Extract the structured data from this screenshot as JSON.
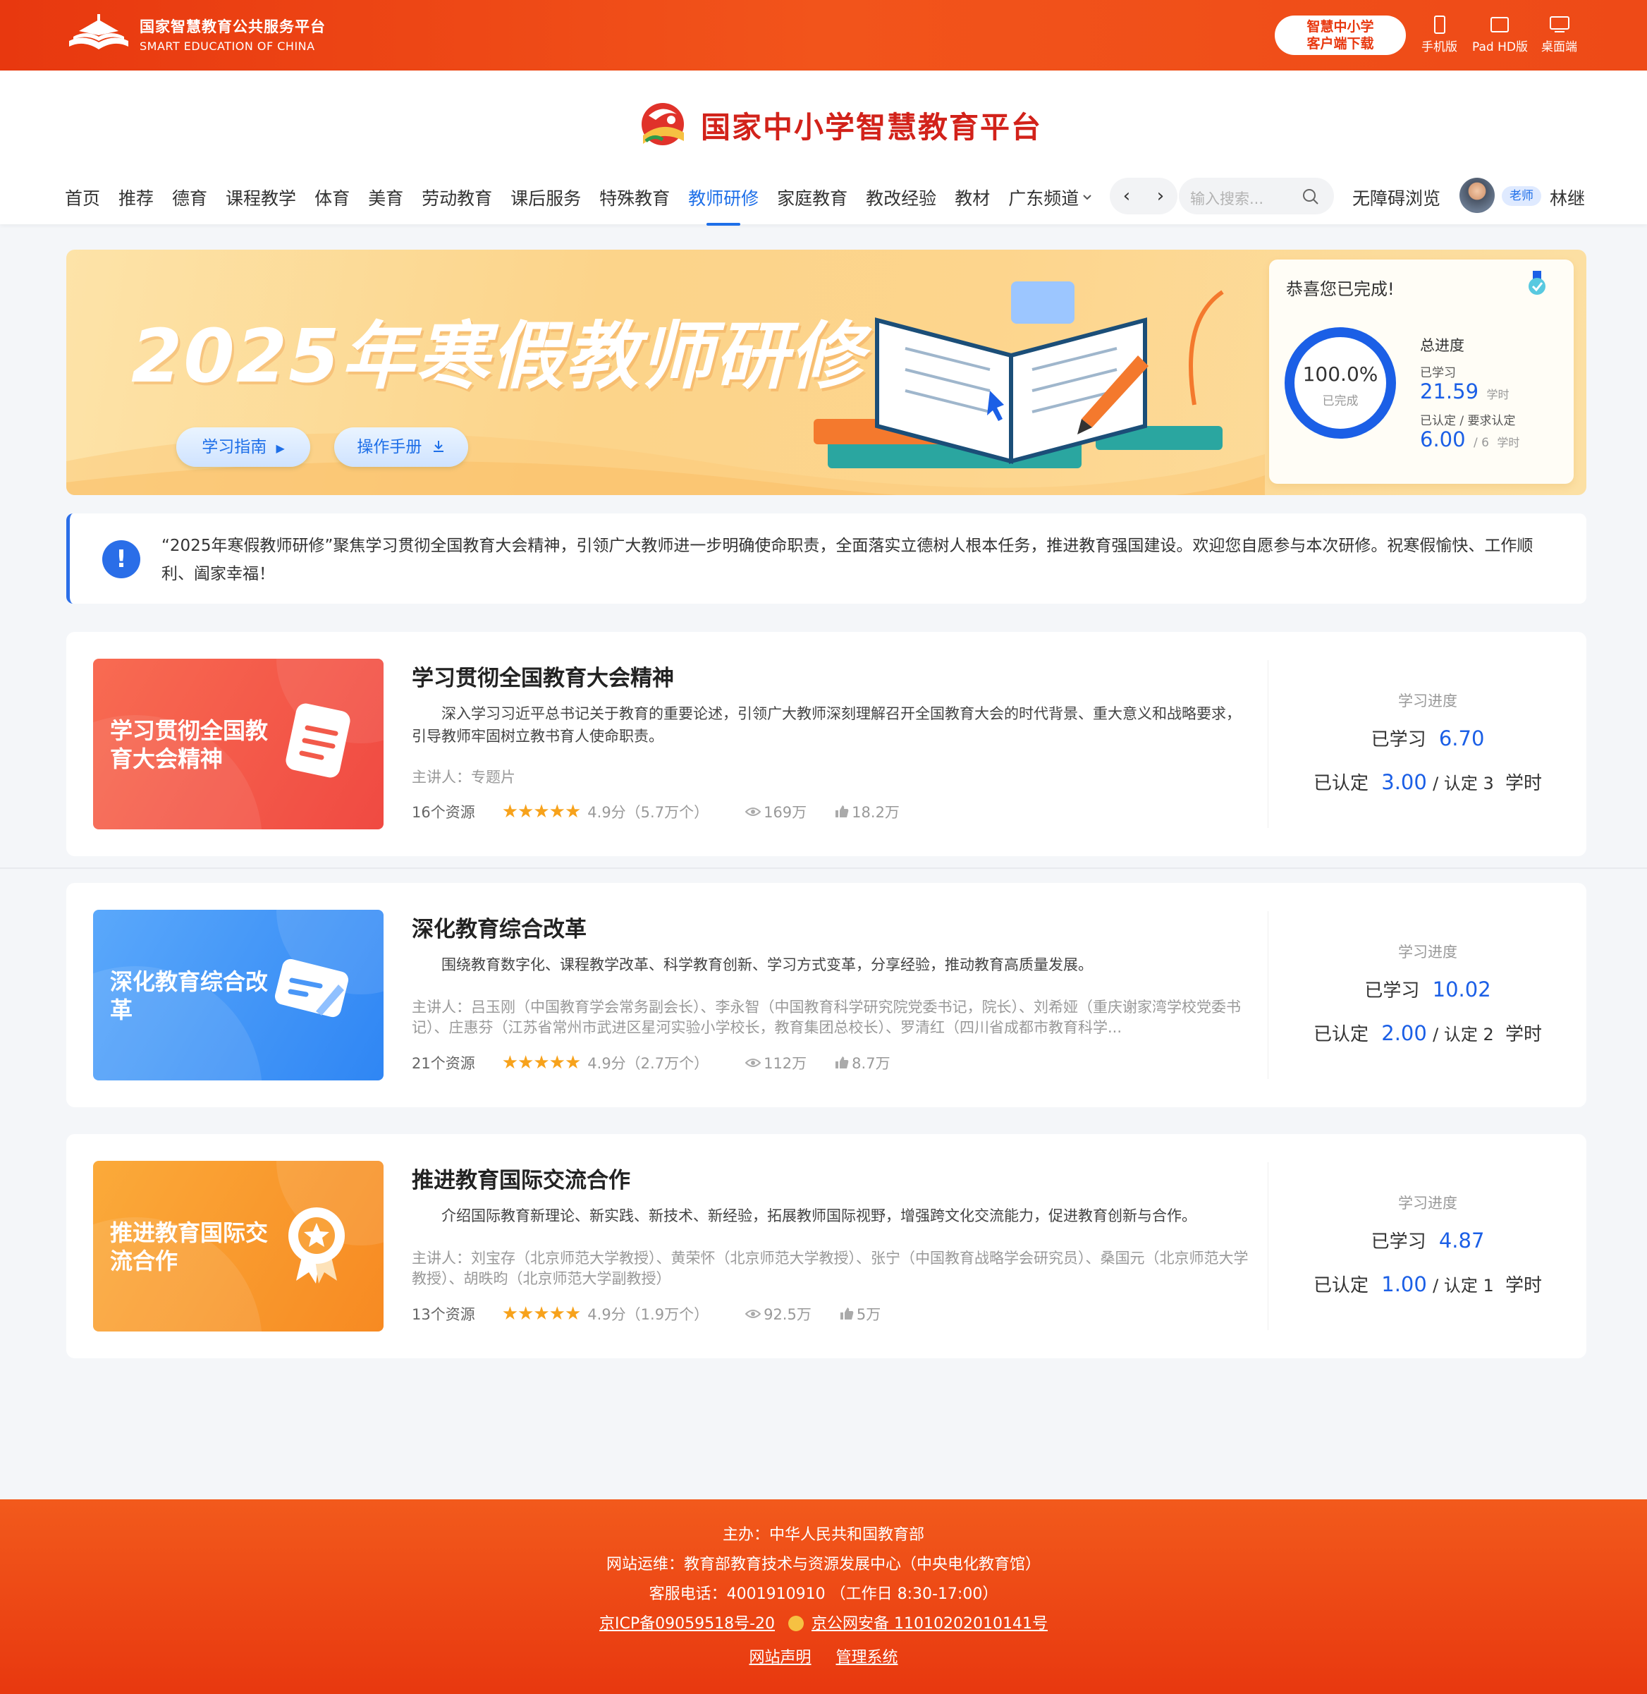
{
  "topbar": {
    "brand_cn": "国家智慧教育公共服务平台",
    "brand_en": "SMART EDUCATION OF CHINA",
    "download_line1": "智慧中小学",
    "download_line2": "客户端下载",
    "devices": [
      "手机版",
      "Pad HD版",
      "桌面端"
    ]
  },
  "header": {
    "site_title": "国家中小学智慧教育平台",
    "nav": [
      "首页",
      "推荐",
      "德育",
      "课程教学",
      "体育",
      "美育",
      "劳动教育",
      "课后服务",
      "特殊教育",
      "教师研修",
      "家庭教育",
      "教改经验",
      "教材",
      "广东频道"
    ],
    "active_nav": "教师研修",
    "search_placeholder": "输入搜索...",
    "accessibility": "无障碍浏览",
    "role_badge": "老师",
    "username": "林继"
  },
  "banner": {
    "title": "2025年寒假教师研修",
    "btn_guide": "学习指南",
    "btn_manual": "操作手册",
    "progress": {
      "heading": "恭喜您已完成!",
      "percent": "100.0%",
      "percent_sub": "已完成",
      "percent_value": 100,
      "total_label": "总进度",
      "studied_label": "已学习",
      "studied_value": "21.59",
      "unit": "学时",
      "cert_label": "已认定 / 要求认定",
      "cert_value": "6.00",
      "cert_required": "/ 6",
      "unit2": "学时"
    }
  },
  "notice": {
    "text": "“2025年寒假教师研修”聚焦学习贯彻全国教育大会精神，引领广大教师进一步明确使命职责，全面落实立德树人根本任务，推进教育强国建设。欢迎您自愿参与本次研修。祝寒假愉快、工作顺利、阖家幸福！"
  },
  "courses": [
    {
      "thumb_text": "学习贯彻全国教育大会精神",
      "title": "学习贯彻全国教育大会精神",
      "desc": "深入学习习近平总书记关于教育的重要论述，引领广大教师深刻理解召开全国教育大会的时代背景、重大意义和战略要求，引导教师牢固树立教书育人使命职责。",
      "lecturer": "主讲人：专题片",
      "resources": "16个资源",
      "stars": "★★★★★",
      "score": "4.9分（5.7万个）",
      "views": "169万",
      "likes": "18.2万",
      "progress_label": "学习进度",
      "studied_label": "已学习",
      "studied": "6.70",
      "cert_label": "已认定",
      "cert": "3.00",
      "cert_req": "/ 认定 3",
      "unit": "学时"
    },
    {
      "thumb_text": "深化教育综合改革",
      "title": "深化教育综合改革",
      "desc": "围绕教育数字化、课程教学改革、科学教育创新、学习方式变革，分享经验，推动教育高质量发展。",
      "lecturer": "主讲人：吕玉刚（中国教育学会常务副会长）、李永智（中国教育科学研究院党委书记，院长）、刘希娅（重庆谢家湾学校党委书记）、庄惠芬（江苏省常州市武进区星河实验小学校长，教育集团总校长）、罗清红（四川省成都市教育科学...",
      "resources": "21个资源",
      "stars": "★★★★★",
      "score": "4.9分（2.7万个）",
      "views": "112万",
      "likes": "8.7万",
      "progress_label": "学习进度",
      "studied_label": "已学习",
      "studied": "10.02",
      "cert_label": "已认定",
      "cert": "2.00",
      "cert_req": "/ 认定 2",
      "unit": "学时"
    },
    {
      "thumb_text": "推进教育国际交流合作",
      "title": "推进教育国际交流合作",
      "desc": "介绍国际教育新理论、新实践、新技术、新经验，拓展教师国际视野，增强跨文化交流能力，促进教育创新与合作。",
      "lecturer": "主讲人：刘宝存（北京师范大学教授）、黄荣怀（北京师范大学教授）、张宁（中国教育战略学会研究员）、桑国元（北京师范大学教授）、胡昳昀（北京师范大学副教授）",
      "resources": "13个资源",
      "stars": "★★★★★",
      "score": "4.9分（1.9万个）",
      "views": "92.5万",
      "likes": "5万",
      "progress_label": "学习进度",
      "studied_label": "已学习",
      "studied": "4.87",
      "cert_label": "已认定",
      "cert": "1.00",
      "cert_req": "/ 认定 1",
      "unit": "学时"
    }
  ],
  "footer": {
    "host": "主办：中华人民共和国教育部",
    "ops": "网站运维：教育部教育技术与资源发展中心（中央电化教育馆）",
    "phone": "客服电话：4001910910 （工作日 8:30-17:00）",
    "icp": "京ICP备09059518号-20",
    "police": "京公网安备 11010202010141号",
    "statement": "网站声明",
    "admin": "管理系统"
  },
  "colors": {
    "brand_orange": "#e8380f",
    "accent_blue": "#1b5fe6",
    "star": "#f7a21b"
  }
}
